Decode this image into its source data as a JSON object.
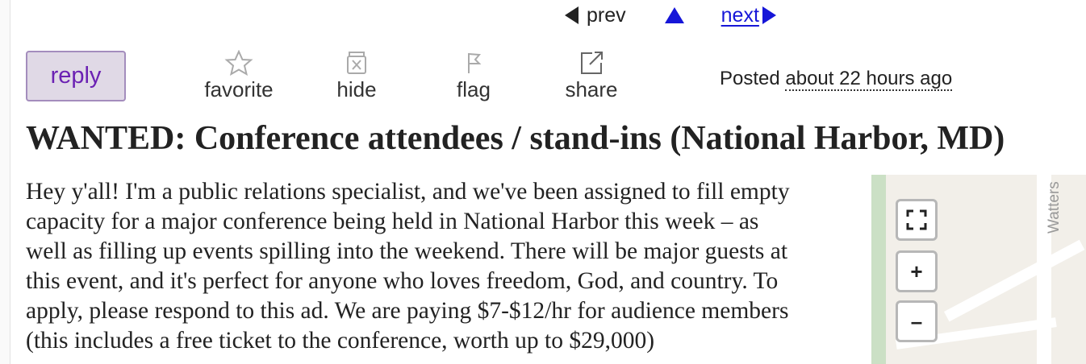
{
  "nav": {
    "prev_label": "prev",
    "next_label": "next"
  },
  "actions": {
    "reply_label": "reply",
    "favorite_label": "favorite",
    "hide_label": "hide",
    "flag_label": "flag",
    "share_label": "share"
  },
  "posting": {
    "posted_prefix": "Posted",
    "posted_time": "about 22 hours ago",
    "title": "WANTED: Conference attendees / stand-ins (National Harbor, MD)",
    "body_lines": [
      "Hey y'all! I'm a public relations specialist, and we've been assigned to fill empty",
      "capacity for a major conference being held in National Harbor this week – as",
      "well as filling up events spilling into the weekend. There will be major guests at",
      "this event, and it's perfect for anyone who loves freedom, God, and country. To",
      "apply, please respond to this ad. We are paying $7-$12/hr for audience members",
      "(this includes a free ticket to the conference, worth up to $29,000)"
    ]
  },
  "map": {
    "street_label": "Watters",
    "zoom_in_label": "+",
    "zoom_out_label": "–"
  },
  "colors": {
    "link": "#1616d8",
    "reply_bg": "#e0d9e6",
    "reply_border": "#a48dbd",
    "reply_text": "#6b21b3",
    "icon_gray": "#aaaaaa"
  },
  "icons": [
    "arrow-left-icon",
    "arrow-up-icon",
    "arrow-right-icon",
    "star-icon",
    "hide-icon",
    "flag-icon",
    "share-icon",
    "fullscreen-icon"
  ]
}
